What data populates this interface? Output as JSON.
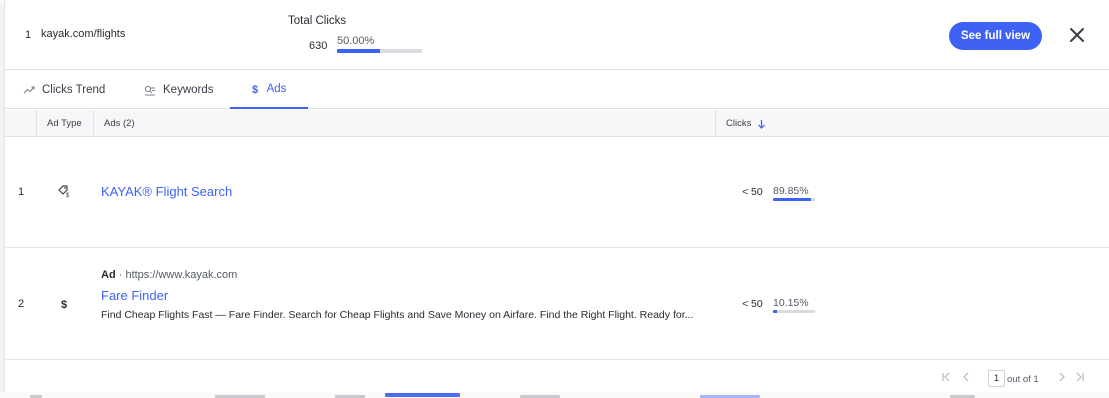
{
  "header": {
    "rank": "1",
    "url": "kayak.com/flights",
    "total_clicks_label": "Total Clicks",
    "total_clicks_value": "630",
    "total_clicks_pct": "50.00%",
    "total_clicks_fraction": 0.5,
    "full_view_label": "See full view",
    "accent_color": "#3f62f4"
  },
  "tabs": [
    {
      "label": "Clicks Trend",
      "icon": "trend-icon",
      "active": false
    },
    {
      "label": "Keywords",
      "icon": "keywords-icon",
      "active": false
    },
    {
      "label": "Ads",
      "icon": "dollar-icon",
      "active": true
    }
  ],
  "table": {
    "columns": [
      "Ad Type",
      "Ads (2)",
      "Clicks"
    ],
    "rows": [
      {
        "rank": "1",
        "type_icon": "shopping-tag-icon",
        "title": "KAYAK® Flight Search",
        "clicks": "< 50",
        "pct": "89.85%",
        "fraction": 0.8985
      },
      {
        "rank": "2",
        "type_icon": "dollar-icon",
        "ad_label": "Ad",
        "ad_url": "https://www.kayak.com",
        "title": "Fare Finder",
        "description": "Find Cheap Flights Fast — Fare Finder. Search for Cheap Flights and Save Money on Airfare. Find the Right Flight. Ready for...",
        "clicks": "< 50",
        "pct": "10.15%",
        "fraction": 0.1015
      }
    ]
  },
  "pagination": {
    "page": "1",
    "of_label": "out of 1"
  }
}
